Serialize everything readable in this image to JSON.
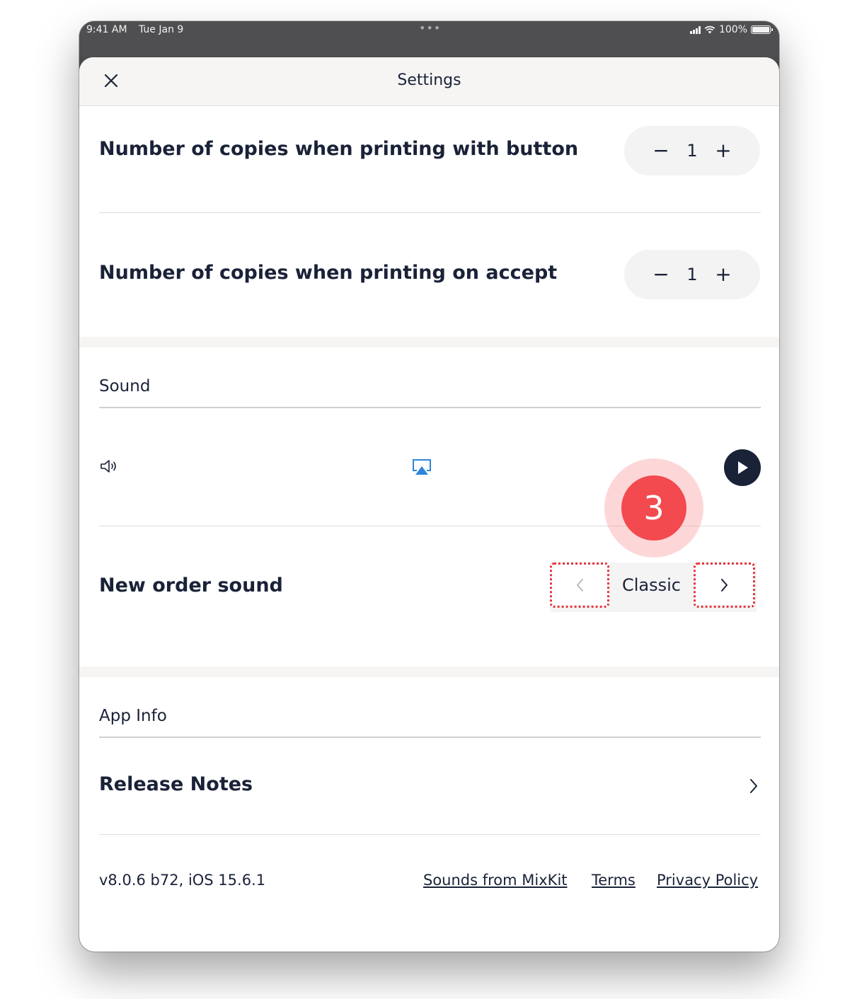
{
  "status_bar": {
    "time": "9:41 AM",
    "date": "Tue Jan 9",
    "battery": "100%"
  },
  "nav": {
    "title": "Settings"
  },
  "printing": {
    "copies_button_label": "Number of copies when printing with button",
    "copies_button_value": "1",
    "copies_accept_label": "Number of copies when printing on accept",
    "copies_accept_value": "1",
    "decrement_symbol": "−",
    "increment_symbol": "+"
  },
  "sound": {
    "header": "Sound",
    "new_order_label": "New order sound",
    "selected_sound": "Classic"
  },
  "annotation": {
    "step_number": "3",
    "accent_color": "#f24a4f"
  },
  "app_info": {
    "header": "App Info",
    "release_notes_label": "Release Notes",
    "version": "v8.0.6 b72, iOS 15.6.1",
    "links": [
      "Sounds from MixKit",
      "Terms",
      "Privacy Policy"
    ]
  },
  "icons": [
    "close-icon",
    "speaker-icon",
    "airplay-icon",
    "play-icon",
    "chevron-left-icon",
    "chevron-right-icon",
    "signal-icon",
    "wifi-icon",
    "battery-icon"
  ],
  "colors": {
    "text_primary": "#1a2238",
    "highlight": "#e4343a"
  }
}
